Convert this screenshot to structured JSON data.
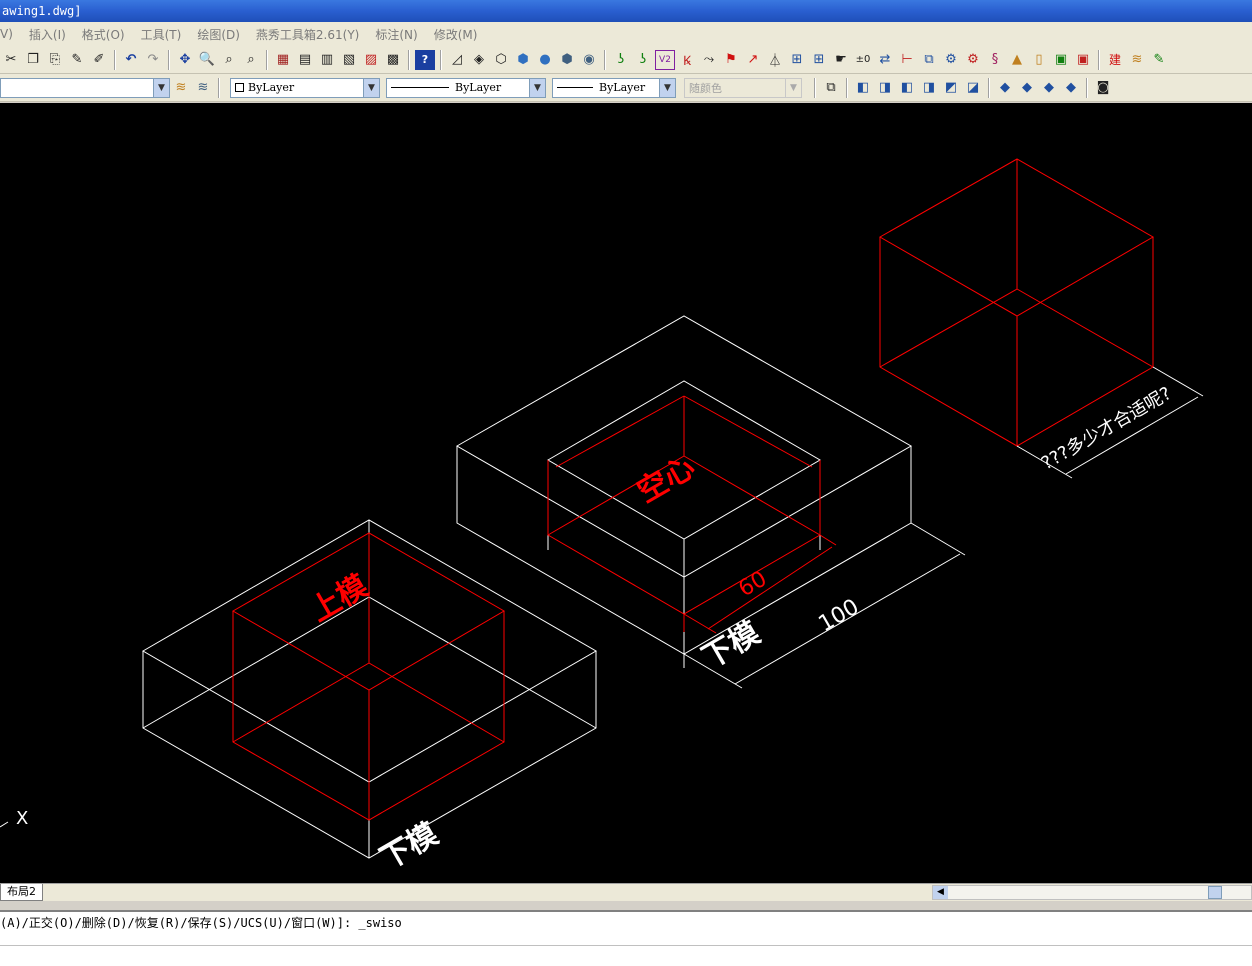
{
  "window": {
    "title": "awing1.dwg]"
  },
  "menu": [
    "V)",
    "插入(I)",
    "格式(O)",
    "工具(T)",
    "绘图(D)",
    "燕秀工具箱2.61(Y)",
    "标注(N)",
    "修改(M)"
  ],
  "toolbar2": {
    "layer_combo": "",
    "color_combo": "ByLayer",
    "linetype_combo": "ByLayer",
    "lineweight_combo": "ByLayer",
    "plotstyle_combo": "随颜色"
  },
  "drawing": {
    "label_upper_mold": "上模",
    "label_lower_mold_left": "下模",
    "label_lower_mold_right": "下模",
    "label_hollow": "空心",
    "dim_inner": "60",
    "dim_outer": "100",
    "dim_question": "???多少才合适呢?",
    "ucs_x_label": "X",
    "colors": {
      "white": "#ffffff",
      "red": "#ff0000"
    }
  },
  "status": {
    "layout_tab": "布局2"
  },
  "command": {
    "line1": "(A)/正交(O)/删除(D)/恢复(R)/保存(S)/UCS(U)/窗口(W)]: _swiso"
  }
}
